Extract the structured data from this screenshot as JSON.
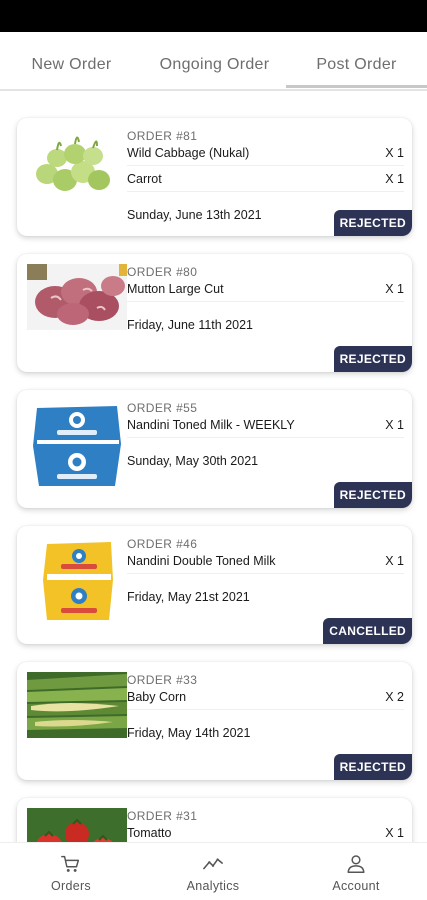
{
  "tabs": [
    {
      "label": "New Order"
    },
    {
      "label": "Ongoing Order"
    },
    {
      "label": "Post Order"
    }
  ],
  "active_tab": "Post Order",
  "orders": [
    {
      "number": "ORDER #81",
      "image": "wild-cabbage-image",
      "items": [
        {
          "name": "Wild Cabbage (Nukal)",
          "qty": "X 1"
        },
        {
          "name": "Carrot",
          "qty": "X 1"
        }
      ],
      "date": "Sunday, June 13th 2021",
      "status": "REJECTED"
    },
    {
      "number": "ORDER #80",
      "image": "mutton-image",
      "items": [
        {
          "name": "Mutton Large Cut",
          "qty": "X 1"
        }
      ],
      "date": "Friday, June 11th 2021",
      "status": "REJECTED"
    },
    {
      "number": "ORDER #55",
      "image": "nandini-toned-milk-image",
      "items": [
        {
          "name": "Nandini Toned Milk - WEEKLY",
          "qty": "X 1"
        }
      ],
      "date": "Sunday, May 30th 2021",
      "status": "REJECTED"
    },
    {
      "number": "ORDER #46",
      "image": "nandini-double-toned-milk-image",
      "items": [
        {
          "name": "Nandini Double Toned Milk",
          "qty": "X 1"
        }
      ],
      "date": "Friday, May 21st 2021",
      "status": "CANCELLED"
    },
    {
      "number": "ORDER #33",
      "image": "baby-corn-image",
      "items": [
        {
          "name": "Baby Corn",
          "qty": "X 2"
        }
      ],
      "date": "Friday, May 14th 2021",
      "status": "REJECTED"
    },
    {
      "number": "ORDER #31",
      "image": "tomato-image",
      "items": [
        {
          "name": "Tomatto",
          "qty": "X 1"
        }
      ],
      "date": "",
      "status": ""
    }
  ],
  "bottom_nav": [
    {
      "label": "Orders",
      "icon": "cart-icon"
    },
    {
      "label": "Analytics",
      "icon": "analytics-icon"
    },
    {
      "label": "Account",
      "icon": "account-icon"
    }
  ],
  "colors": {
    "badge": "#2c3354",
    "status_bar": "#000000",
    "muted_text": "#6e6e6e"
  }
}
